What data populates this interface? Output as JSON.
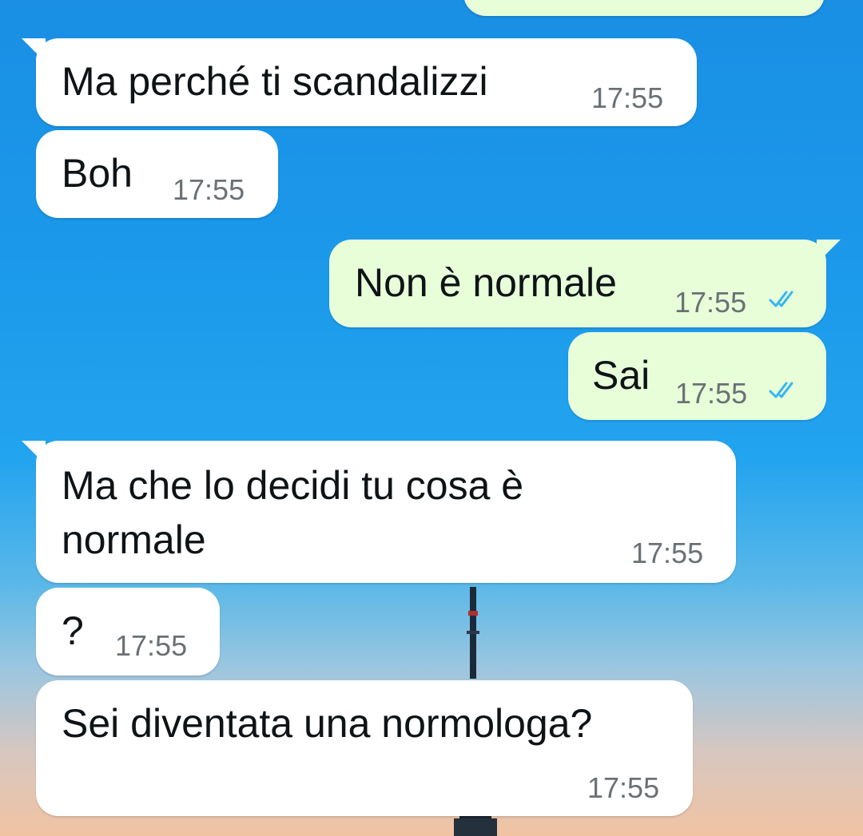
{
  "chat": {
    "messages": [
      {
        "direction": "incoming",
        "text": "Ma perché ti scandalizzi",
        "time": "17:55"
      },
      {
        "direction": "incoming",
        "text": "Boh",
        "time": "17:55"
      },
      {
        "direction": "outgoing",
        "text": "Non è normale",
        "time": "17:55",
        "status": "read"
      },
      {
        "direction": "outgoing",
        "text": "Sai",
        "time": "17:55",
        "status": "read"
      },
      {
        "direction": "incoming",
        "text_line1": "Ma che lo decidi tu cosa è",
        "text_line2": "normale",
        "time": "17:55"
      },
      {
        "direction": "incoming",
        "text": "?",
        "time": "17:55"
      },
      {
        "direction": "incoming",
        "text": "Sei diventata una normologa?",
        "time": "17:55"
      }
    ]
  },
  "colors": {
    "incoming_bubble": "#ffffff",
    "outgoing_bubble": "#e7fed9",
    "read_ticks": "#34b7f1",
    "timestamp": "#6a7175"
  },
  "icons": {
    "read_receipt": "double-check-icon"
  }
}
